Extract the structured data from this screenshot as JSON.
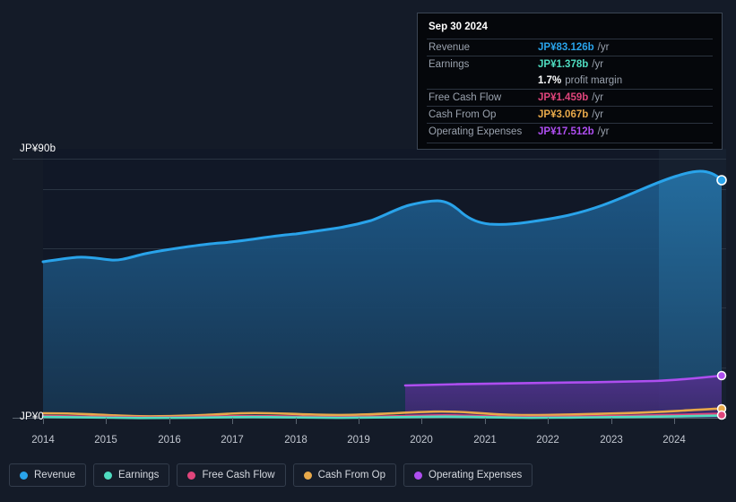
{
  "colors": {
    "background": "#141b28",
    "plot_background": "#111827",
    "revenue": "#29a3ea",
    "earnings": "#4fdcc0",
    "free_cash_flow": "#e0457b",
    "cash_from_op": "#e8a94a",
    "operating_expenses": "#ae4ef0",
    "gridline": "#2a3442",
    "tooltip_background": "#05070b",
    "tooltip_border": "#3b4554"
  },
  "tooltip": {
    "date": "Sep 30 2024",
    "rows": [
      {
        "name": "Revenue",
        "value": "JP¥83.126b",
        "unit": "/yr",
        "color_key": "revenue"
      },
      {
        "name": "Earnings",
        "value": "JP¥1.378b",
        "unit": "/yr",
        "color_key": "earnings"
      },
      {
        "name": "",
        "value": "1.7%",
        "unit": "profit margin",
        "color_key": "white"
      },
      {
        "name": "Free Cash Flow",
        "value": "JP¥1.459b",
        "unit": "/yr",
        "color_key": "free_cash_flow"
      },
      {
        "name": "Cash From Op",
        "value": "JP¥3.067b",
        "unit": "/yr",
        "color_key": "cash_from_op"
      },
      {
        "name": "Operating Expenses",
        "value": "JP¥17.512b",
        "unit": "/yr",
        "color_key": "operating_expenses"
      }
    ]
  },
  "axes": {
    "y_top_label": "JP¥90b",
    "y_zero_label": "JP¥0",
    "x_ticks": [
      "2014",
      "2015",
      "2016",
      "2017",
      "2018",
      "2019",
      "2020",
      "2021",
      "2022",
      "2023",
      "2024"
    ]
  },
  "legend": {
    "items": [
      {
        "label": "Revenue",
        "color_key": "revenue"
      },
      {
        "label": "Earnings",
        "color_key": "earnings"
      },
      {
        "label": "Free Cash Flow",
        "color_key": "free_cash_flow"
      },
      {
        "label": "Cash From Op",
        "color_key": "cash_from_op"
      },
      {
        "label": "Operating Expenses",
        "color_key": "operating_expenses"
      }
    ]
  },
  "chart_data": {
    "type": "area",
    "title": "",
    "xlabel": "",
    "ylabel": "JP¥",
    "currency": "JP¥",
    "unit": "b",
    "ylim": [
      0,
      90
    ],
    "xlim": [
      2014,
      2024.75
    ],
    "grid": true,
    "gridline_values": [
      90,
      75,
      60,
      45,
      30,
      15,
      0
    ],
    "legend_position": "bottom-left",
    "x": [
      2014.0,
      2014.5,
      2015.0,
      2015.5,
      2016.0,
      2016.5,
      2017.0,
      2017.5,
      2018.0,
      2018.5,
      2019.0,
      2019.5,
      2020.0,
      2020.5,
      2021.0,
      2021.25,
      2021.75,
      2022.0,
      2022.5,
      2023.0,
      2023.5,
      2024.0,
      2024.5,
      2024.75
    ],
    "series": [
      {
        "name": "Revenue",
        "color_key": "revenue",
        "filled": true,
        "values": [
          52.0,
          53.2,
          54.0,
          53.4,
          55.4,
          57.6,
          58.6,
          59.5,
          60.4,
          61.5,
          62.4,
          63.8,
          66.8,
          70.6,
          72.4,
          72.6,
          68.4,
          65.8,
          65.6,
          67.0,
          69.8,
          73.4,
          79.4,
          83.126
        ]
      },
      {
        "name": "Operating Expenses",
        "color_key": "operating_expenses",
        "filled": true,
        "starts_at_x": 2019.7,
        "values": [
          null,
          null,
          null,
          null,
          null,
          null,
          null,
          null,
          null,
          null,
          null,
          null,
          10.8,
          11.0,
          11.2,
          11.2,
          11.3,
          11.4,
          11.5,
          11.7,
          12.0,
          12.6,
          14.9,
          17.512
        ]
      },
      {
        "name": "Cash From Op",
        "color_key": "cash_from_op",
        "filled": false,
        "values": [
          1.5,
          1.5,
          1.4,
          1.2,
          1.1,
          1.2,
          1.3,
          1.4,
          1.6,
          1.8,
          2.0,
          1.9,
          1.7,
          1.8,
          2.2,
          2.3,
          2.1,
          1.8,
          1.7,
          1.8,
          2.0,
          2.2,
          2.6,
          3.067
        ]
      },
      {
        "name": "Free Cash Flow",
        "color_key": "free_cash_flow",
        "filled": false,
        "values": [
          0.6,
          0.6,
          0.5,
          0.4,
          0.3,
          0.4,
          0.5,
          0.6,
          0.7,
          0.9,
          1.0,
          0.9,
          0.8,
          0.9,
          1.2,
          1.3,
          1.1,
          0.8,
          0.7,
          0.8,
          0.9,
          1.1,
          1.3,
          1.459
        ]
      },
      {
        "name": "Earnings",
        "color_key": "earnings",
        "filled": false,
        "values": [
          0.3,
          0.3,
          0.3,
          0.2,
          0.2,
          0.3,
          0.3,
          0.4,
          0.5,
          0.6,
          0.7,
          0.6,
          0.5,
          0.6,
          0.8,
          0.9,
          0.8,
          0.6,
          0.5,
          0.6,
          0.7,
          0.9,
          1.1,
          1.378
        ]
      }
    ],
    "endpoint_markers": [
      "Revenue",
      "Operating Expenses",
      "Cash From Op",
      "Free Cash Flow"
    ],
    "highlight_band": {
      "from_x": 2023.75,
      "to_x": 2024.75
    }
  }
}
